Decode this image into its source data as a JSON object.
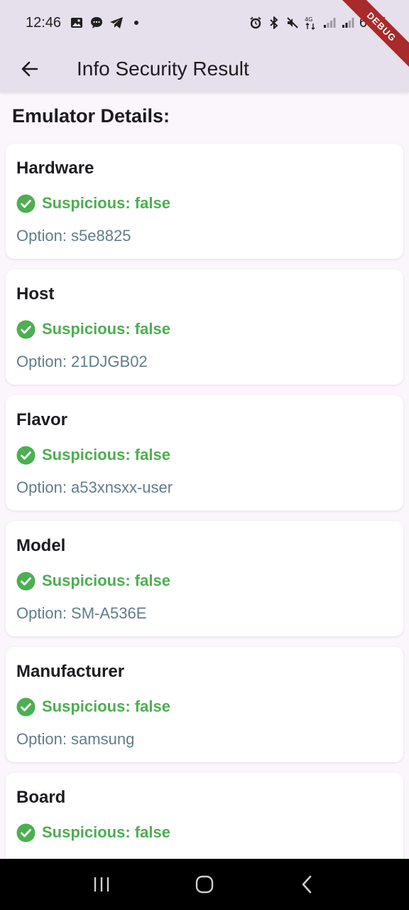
{
  "status_bar": {
    "time": "12:46",
    "battery": "68%"
  },
  "app_bar": {
    "title": "Info Security Result"
  },
  "debug_banner": "DEBUG",
  "section_title": "Emulator Details:",
  "cards": [
    {
      "title": "Hardware",
      "status": "Suspicious: false",
      "option": "Option: s5e8825"
    },
    {
      "title": "Host",
      "status": "Suspicious: false",
      "option": "Option: 21DJGB02"
    },
    {
      "title": "Flavor",
      "status": "Suspicious: false",
      "option": "Option: a53xnsxx-user"
    },
    {
      "title": "Model",
      "status": "Suspicious: false",
      "option": "Option: SM-A536E"
    },
    {
      "title": "Manufacturer",
      "status": "Suspicious: false",
      "option": "Option: samsung"
    },
    {
      "title": "Board",
      "status": "Suspicious: false",
      "option": ""
    }
  ],
  "colors": {
    "success": "#4caf50",
    "option": "#607d8b",
    "app_bar": "#e6e0ec",
    "background": "#fbf5fc"
  }
}
